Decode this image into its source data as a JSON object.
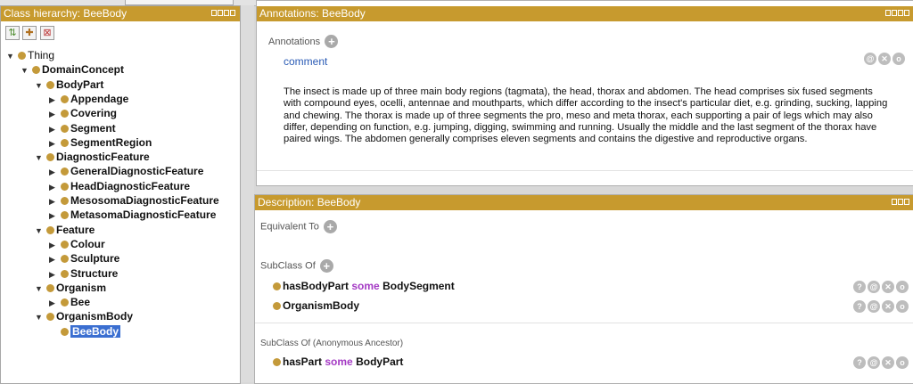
{
  "left_panel": {
    "title": "Class hierarchy: BeeBody",
    "tree": [
      {
        "label": "Thing",
        "arrow": "▼",
        "bold": false
      },
      {
        "label": "DomainConcept",
        "arrow": "▼",
        "bold": true
      },
      {
        "label": "BodyPart",
        "arrow": "▼",
        "bold": true
      },
      {
        "label": "Appendage",
        "arrow": "▶",
        "bold": true
      },
      {
        "label": "Covering",
        "arrow": "▶",
        "bold": true
      },
      {
        "label": "Segment",
        "arrow": "▶",
        "bold": true
      },
      {
        "label": "SegmentRegion",
        "arrow": "▶",
        "bold": true
      },
      {
        "label": "DiagnosticFeature",
        "arrow": "▼",
        "bold": true
      },
      {
        "label": "GeneralDiagnosticFeature",
        "arrow": "▶",
        "bold": true
      },
      {
        "label": "HeadDiagnosticFeature",
        "arrow": "▶",
        "bold": true
      },
      {
        "label": "MesosomaDiagnosticFeature",
        "arrow": "▶",
        "bold": true
      },
      {
        "label": "MetasomaDiagnosticFeature",
        "arrow": "▶",
        "bold": true
      },
      {
        "label": "Feature",
        "arrow": "▼",
        "bold": true
      },
      {
        "label": "Colour",
        "arrow": "▶",
        "bold": true
      },
      {
        "label": "Sculpture",
        "arrow": "▶",
        "bold": true
      },
      {
        "label": "Structure",
        "arrow": "▶",
        "bold": true
      },
      {
        "label": "Organism",
        "arrow": "▼",
        "bold": true
      },
      {
        "label": "Bee",
        "arrow": "▶",
        "bold": true
      },
      {
        "label": "OrganismBody",
        "arrow": "▼",
        "bold": true
      },
      {
        "label": "BeeBody",
        "arrow": "",
        "bold": true,
        "selected": true
      }
    ]
  },
  "annotations_panel": {
    "title": "Annotations: BeeBody",
    "section_label": "Annotations",
    "annotation_property": "comment",
    "annotation_text": "The insect is made up of three main body regions (tagmata), the head, thorax and abdomen. The head comprises six fused segments with compound eyes, ocelli, antennae and mouthparts, which differ according to the insect's particular diet, e.g. grinding, sucking, lapping and chewing. The thorax is made up of three segments the pro, meso and meta thorax, each supporting a pair of legs which may also differ, depending on function, e.g. jumping, digging, swimming and running. Usually the middle and the last segment of the thorax have paired wings. The abdomen generally comprises eleven segments and contains the digestive and reproductive organs."
  },
  "description_panel": {
    "title": "Description: BeeBody",
    "equivalent_to_label": "Equivalent To",
    "subclass_of_label": "SubClass Of",
    "axiom1_prop": "hasBodyPart",
    "axiom1_kw": "some",
    "axiom1_filler": "BodySegment",
    "axiom2": "OrganismBody",
    "anon_label": "SubClass Of (Anonymous Ancestor)",
    "axiom3_prop": "hasPart",
    "axiom3_kw": "some",
    "axiom3_filler": "BodyPart"
  },
  "colors": {
    "header": "#c79a2e",
    "class_dot": "#c49a3a",
    "selection": "#3b6fd1",
    "keyword": "#a43ac4"
  }
}
